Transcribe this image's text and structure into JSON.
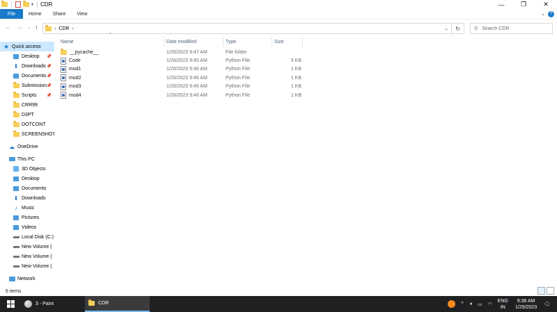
{
  "window": {
    "title": "CDR",
    "controls": {
      "minimize": "—",
      "maximize": "❐",
      "close": "✕"
    }
  },
  "ribbon": {
    "tabs": [
      "File",
      "Home",
      "Share",
      "View"
    ]
  },
  "address": {
    "path": [
      "CDR"
    ],
    "search_placeholder": "Search CDR"
  },
  "nav_pane": {
    "quick_access_label": "Quick access",
    "quick_access_items": [
      {
        "label": "Desktop",
        "icon": "desktop-icon",
        "pinned": true
      },
      {
        "label": "Downloads",
        "icon": "downloads-icon",
        "pinned": true
      },
      {
        "label": "Documents",
        "icon": "documents-icon",
        "pinned": true
      },
      {
        "label": "Submission",
        "icon": "folder-icon",
        "pinned": true
      },
      {
        "label": "Scripts",
        "icon": "folder-icon",
        "pinned": true
      },
      {
        "label": "CRR99",
        "icon": "folder-icon",
        "pinned": false
      },
      {
        "label": "D3PT",
        "icon": "folder-icon",
        "pinned": false
      },
      {
        "label": "DOTCONT",
        "icon": "folder-icon",
        "pinned": false
      },
      {
        "label": "SCREENSHOTS",
        "icon": "folder-icon",
        "pinned": false
      }
    ],
    "onedrive_label": "OneDrive",
    "this_pc_label": "This PC",
    "this_pc_items": [
      {
        "label": "3D Objects",
        "icon": "3d-objects-icon"
      },
      {
        "label": "Desktop",
        "icon": "desktop-icon"
      },
      {
        "label": "Documents",
        "icon": "documents-icon"
      },
      {
        "label": "Downloads",
        "icon": "downloads-icon"
      },
      {
        "label": "Music",
        "icon": "music-icon"
      },
      {
        "label": "Pictures",
        "icon": "pictures-icon"
      },
      {
        "label": "Videos",
        "icon": "videos-icon"
      },
      {
        "label": "Local Disk (C:)",
        "icon": "local-disk-icon"
      },
      {
        "label": "New Volume (",
        "icon": "drive-icon"
      },
      {
        "label": "New Volume (",
        "icon": "drive-icon"
      },
      {
        "label": "New Volume (",
        "icon": "drive-icon"
      }
    ],
    "network_label": "Network"
  },
  "file_list": {
    "columns": [
      "Name",
      "Date modified",
      "Type",
      "Size"
    ],
    "rows": [
      {
        "name": "__pycache__",
        "date": "1/28/2023 9:47 AM",
        "type": "File folder",
        "size": "",
        "kind": "folder"
      },
      {
        "name": "Code",
        "date": "1/28/2023 9:45 AM",
        "type": "Python File",
        "size": "5 KB",
        "kind": "python"
      },
      {
        "name": "mod1",
        "date": "1/28/2023 9:46 AM",
        "type": "Python File",
        "size": "1 KB",
        "kind": "python"
      },
      {
        "name": "mod2",
        "date": "1/28/2023 9:46 AM",
        "type": "Python File",
        "size": "1 KB",
        "kind": "python"
      },
      {
        "name": "mod3",
        "date": "1/28/2023 9:46 AM",
        "type": "Python File",
        "size": "1 KB",
        "kind": "python"
      },
      {
        "name": "mod4",
        "date": "1/28/2023 9:46 AM",
        "type": "Python File",
        "size": "1 KB",
        "kind": "python"
      }
    ]
  },
  "status_bar": {
    "item_count": "6 items"
  },
  "taskbar": {
    "apps": [
      {
        "label": "3 - Paint",
        "icon": "paint-icon",
        "active": false
      },
      {
        "label": "CDR",
        "icon": "folder-icon",
        "active": true
      }
    ],
    "tray": {
      "lang_top": "ENG",
      "lang_bottom": "IN",
      "time": "9:38 AM",
      "date": "1/29/2023"
    }
  },
  "colors": {
    "accent": "#1979ca",
    "selection": "#cce8ff",
    "taskbar": "#1f2022",
    "folder": "#f6cf58"
  }
}
